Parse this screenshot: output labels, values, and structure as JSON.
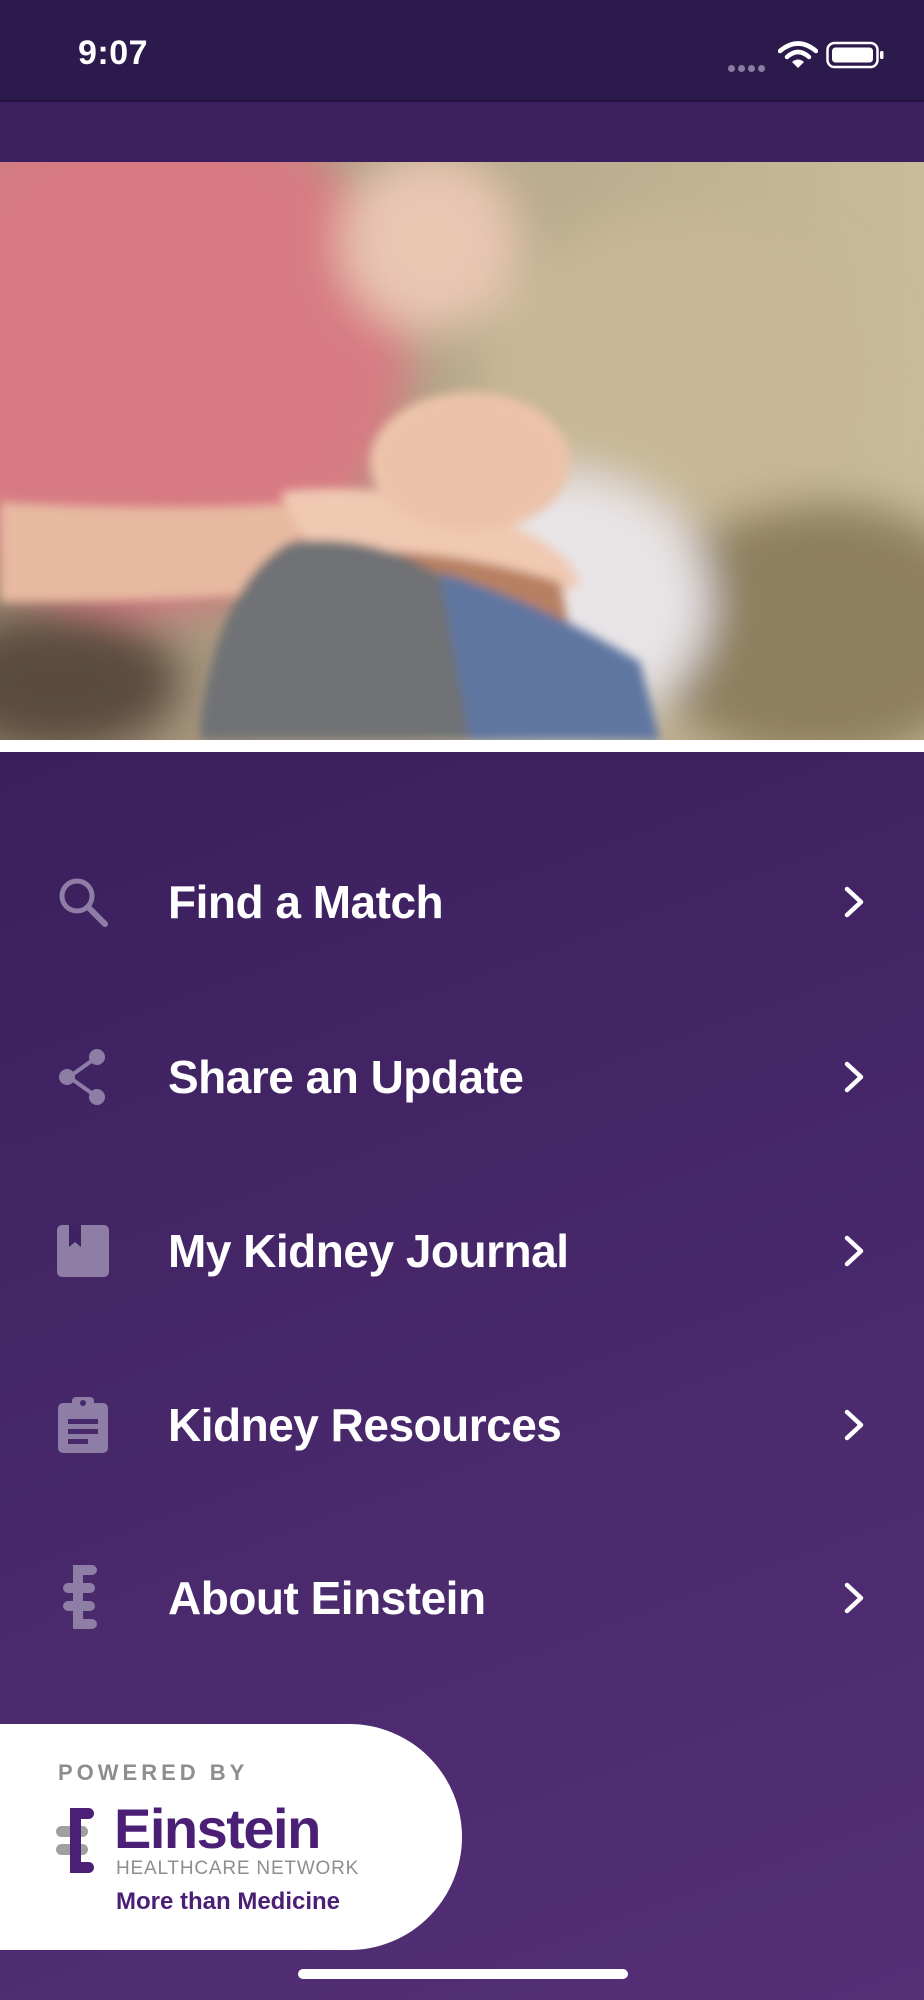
{
  "status_bar": {
    "time": "9:07",
    "signal_icon": "cellular-signal-icon",
    "wifi_icon": "wifi-icon",
    "battery_icon": "battery-icon"
  },
  "hero": {
    "image": "photo-holding-hands"
  },
  "menu": [
    {
      "label": "Find a Match",
      "icon": "search-icon"
    },
    {
      "label": "Share an Update",
      "icon": "share-icon"
    },
    {
      "label": "My Kidney Journal",
      "icon": "journal-icon"
    },
    {
      "label": "Kidney Resources",
      "icon": "clipboard-icon"
    },
    {
      "label": "About Einstein",
      "icon": "einstein-logo-icon"
    }
  ],
  "footer_brand": {
    "powered_by": "POWERED BY",
    "name": "Einstein",
    "subtitle": "HEALTHCARE NETWORK",
    "tagline": "More than Medicine"
  },
  "colors": {
    "header": "#2c1a4d",
    "panel_top": "#3a1f5c",
    "panel_bottom": "#552f76",
    "brand_purple": "#4a1f75",
    "icon_muted": "#8a7ca0"
  }
}
